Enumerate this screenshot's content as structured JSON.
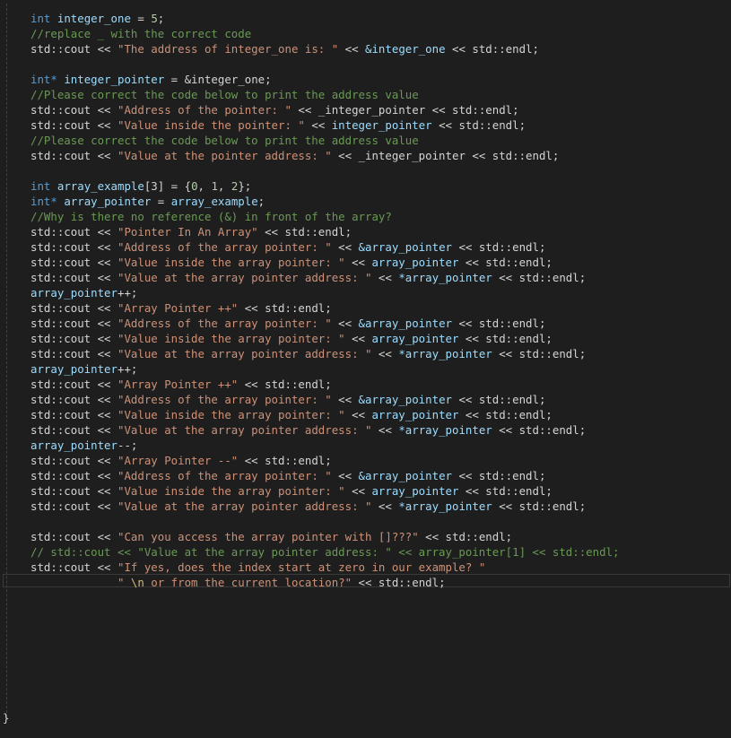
{
  "editor": {
    "lines": [
      [
        {
          "t": "int",
          "c": "kw"
        },
        {
          "t": " "
        },
        {
          "t": "integer_one",
          "c": "var"
        },
        {
          "t": " = "
        },
        {
          "t": "5",
          "c": "num"
        },
        {
          "t": ";"
        }
      ],
      [
        {
          "t": "//replace _ with the correct code",
          "c": "com"
        }
      ],
      [
        {
          "t": "std::cout << "
        },
        {
          "t": "\"The address of integer_one is: \"",
          "c": "str"
        },
        {
          "t": " << "
        },
        {
          "t": "&integer_one",
          "c": "var"
        },
        {
          "t": " << std::endl;"
        }
      ],
      [],
      [
        {
          "t": "int*",
          "c": "kw"
        },
        {
          "t": " "
        },
        {
          "t": "integer_pointer",
          "c": "var"
        },
        {
          "t": " = &integer_one;"
        }
      ],
      [
        {
          "t": "//Please correct the code below to print the address value",
          "c": "com"
        }
      ],
      [
        {
          "t": "std::cout << "
        },
        {
          "t": "\"Address of the pointer: \"",
          "c": "str"
        },
        {
          "t": " << _integer_pointer << std::endl;"
        }
      ],
      [
        {
          "t": "std::cout << "
        },
        {
          "t": "\"Value inside the pointer: \"",
          "c": "str"
        },
        {
          "t": " << "
        },
        {
          "t": "integer_pointer",
          "c": "var"
        },
        {
          "t": " << std::endl;"
        }
      ],
      [
        {
          "t": "//Please correct the code below to print the address value",
          "c": "com"
        }
      ],
      [
        {
          "t": "std::cout << "
        },
        {
          "t": "\"Value at the pointer address: \"",
          "c": "str"
        },
        {
          "t": " << _integer_pointer << std::endl;"
        }
      ],
      [],
      [
        {
          "t": "int",
          "c": "kw"
        },
        {
          "t": " "
        },
        {
          "t": "array_example",
          "c": "var"
        },
        {
          "t": "[3] = {"
        },
        {
          "t": "0",
          "c": "num"
        },
        {
          "t": ", "
        },
        {
          "t": "1",
          "c": "num"
        },
        {
          "t": ", "
        },
        {
          "t": "2",
          "c": "num"
        },
        {
          "t": "};"
        }
      ],
      [
        {
          "t": "int*",
          "c": "kw"
        },
        {
          "t": " "
        },
        {
          "t": "array_pointer",
          "c": "var"
        },
        {
          "t": " = "
        },
        {
          "t": "array_example",
          "c": "var"
        },
        {
          "t": ";"
        }
      ],
      [
        {
          "t": "//Why is there no reference (&) in front of the array?",
          "c": "com"
        }
      ],
      [
        {
          "t": "std::cout << "
        },
        {
          "t": "\"Pointer In An Array\"",
          "c": "str"
        },
        {
          "t": " << std::endl;"
        }
      ],
      [
        {
          "t": "std::cout << "
        },
        {
          "t": "\"Address of the array pointer: \"",
          "c": "str"
        },
        {
          "t": " << "
        },
        {
          "t": "&array_pointer",
          "c": "var"
        },
        {
          "t": " << std::endl;"
        }
      ],
      [
        {
          "t": "std::cout << "
        },
        {
          "t": "\"Value inside the array pointer: \"",
          "c": "str"
        },
        {
          "t": " << "
        },
        {
          "t": "array_pointer",
          "c": "var"
        },
        {
          "t": " << std::endl;"
        }
      ],
      [
        {
          "t": "std::cout << "
        },
        {
          "t": "\"Value at the array pointer address: \"",
          "c": "str"
        },
        {
          "t": " << "
        },
        {
          "t": "*array_pointer",
          "c": "var"
        },
        {
          "t": " << std::endl;"
        }
      ],
      [
        {
          "t": "array_pointer",
          "c": "var"
        },
        {
          "t": "++;"
        }
      ],
      [
        {
          "t": "std::cout << "
        },
        {
          "t": "\"Array Pointer ++\"",
          "c": "str"
        },
        {
          "t": " << std::endl;"
        }
      ],
      [
        {
          "t": "std::cout << "
        },
        {
          "t": "\"Address of the array pointer: \"",
          "c": "str"
        },
        {
          "t": " << "
        },
        {
          "t": "&array_pointer",
          "c": "var"
        },
        {
          "t": " << std::endl;"
        }
      ],
      [
        {
          "t": "std::cout << "
        },
        {
          "t": "\"Value inside the array pointer: \"",
          "c": "str"
        },
        {
          "t": " << "
        },
        {
          "t": "array_pointer",
          "c": "var"
        },
        {
          "t": " << std::endl;"
        }
      ],
      [
        {
          "t": "std::cout << "
        },
        {
          "t": "\"Value at the array pointer address: \"",
          "c": "str"
        },
        {
          "t": " << "
        },
        {
          "t": "*array_pointer",
          "c": "var"
        },
        {
          "t": " << std::endl;"
        }
      ],
      [
        {
          "t": "array_pointer",
          "c": "var"
        },
        {
          "t": "++;"
        }
      ],
      [
        {
          "t": "std::cout << "
        },
        {
          "t": "\"Array Pointer ++\"",
          "c": "str"
        },
        {
          "t": " << std::endl;"
        }
      ],
      [
        {
          "t": "std::cout << "
        },
        {
          "t": "\"Address of the array pointer: \"",
          "c": "str"
        },
        {
          "t": " << "
        },
        {
          "t": "&array_pointer",
          "c": "var"
        },
        {
          "t": " << std::endl;"
        }
      ],
      [
        {
          "t": "std::cout << "
        },
        {
          "t": "\"Value inside the array pointer: \"",
          "c": "str"
        },
        {
          "t": " << "
        },
        {
          "t": "array_pointer",
          "c": "var"
        },
        {
          "t": " << std::endl;"
        }
      ],
      [
        {
          "t": "std::cout << "
        },
        {
          "t": "\"Value at the array pointer address: \"",
          "c": "str"
        },
        {
          "t": " << "
        },
        {
          "t": "*array_pointer",
          "c": "var"
        },
        {
          "t": " << std::endl;"
        }
      ],
      [
        {
          "t": "array_pointer",
          "c": "var"
        },
        {
          "t": "--;"
        }
      ],
      [
        {
          "t": "std::cout << "
        },
        {
          "t": "\"Array Pointer --\"",
          "c": "str"
        },
        {
          "t": " << std::endl;"
        }
      ],
      [
        {
          "t": "std::cout << "
        },
        {
          "t": "\"Address of the array pointer: \"",
          "c": "str"
        },
        {
          "t": " << "
        },
        {
          "t": "&array_pointer",
          "c": "var"
        },
        {
          "t": " << std::endl;"
        }
      ],
      [
        {
          "t": "std::cout << "
        },
        {
          "t": "\"Value inside the array pointer: \"",
          "c": "str"
        },
        {
          "t": " << "
        },
        {
          "t": "array_pointer",
          "c": "var"
        },
        {
          "t": " << std::endl;"
        }
      ],
      [
        {
          "t": "std::cout << "
        },
        {
          "t": "\"Value at the array pointer address: \"",
          "c": "str"
        },
        {
          "t": " << "
        },
        {
          "t": "*array_pointer",
          "c": "var"
        },
        {
          "t": " << std::endl;"
        }
      ],
      [],
      [
        {
          "t": "std::cout << "
        },
        {
          "t": "\"Can you access the array pointer with []???\"",
          "c": "str"
        },
        {
          "t": " << std::endl;"
        }
      ],
      [
        {
          "t": "// std::cout << \"Value at the array pointer address: \" << array_pointer[1] << std::endl;",
          "c": "com"
        }
      ],
      [
        {
          "t": "std::cout << "
        },
        {
          "t": "\"If yes, does the index start at zero in our example? \"",
          "c": "str"
        }
      ],
      [
        {
          "t": "             "
        },
        {
          "t": "\" ",
          "c": "str"
        },
        {
          "t": "\\n",
          "c": "esc"
        },
        {
          "t": " or from the current location?\"",
          "c": "str"
        },
        {
          "t": " << std::endl;"
        }
      ]
    ],
    "closing_brace": "}"
  }
}
